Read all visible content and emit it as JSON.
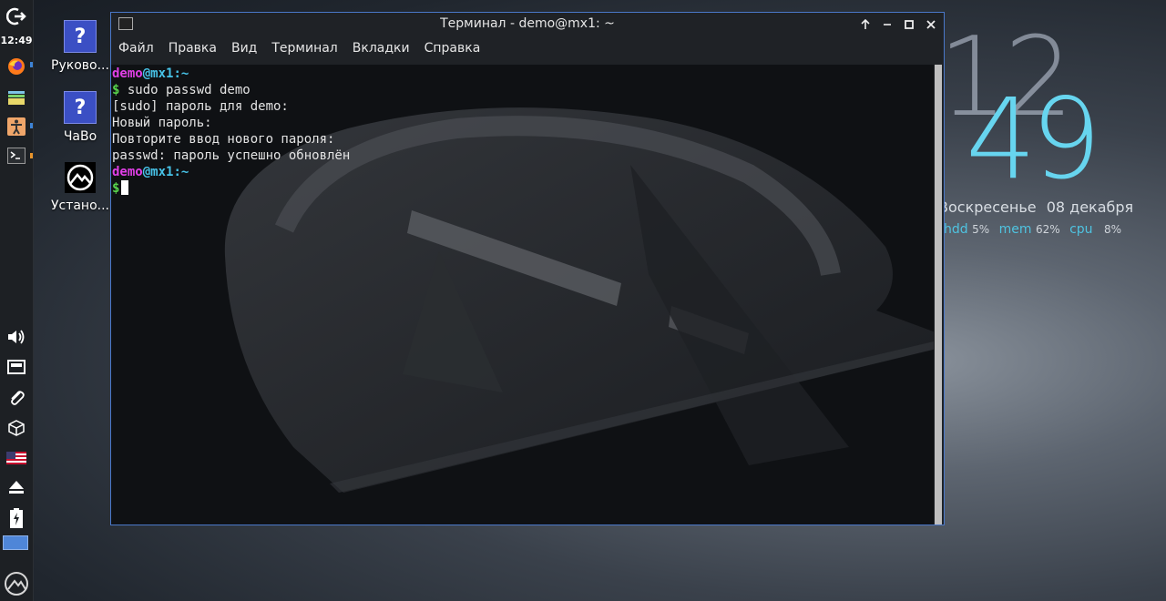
{
  "panel": {
    "time": "12:49",
    "indicator_color": "#3d83d6"
  },
  "desktop": {
    "icons": [
      {
        "label": "Руково...",
        "icon": "help-icon"
      },
      {
        "label": "ЧаВо",
        "icon": "help-icon"
      },
      {
        "label": "Устано...",
        "icon": "mx-installer-icon"
      }
    ]
  },
  "conky": {
    "hour": "12",
    "minute": "49",
    "weekday": "Воскресенье",
    "date": "08 декабря",
    "stats": [
      {
        "label": "hdd",
        "value": "5%"
      },
      {
        "label": "mem",
        "value": "62%"
      },
      {
        "label": "cpu",
        "value": "8%"
      }
    ]
  },
  "terminal": {
    "title": "Терминал - demo@mx1: ~",
    "menu": [
      "Файл",
      "Правка",
      "Вид",
      "Терминал",
      "Вкладки",
      "Справка"
    ],
    "user": "demo",
    "host": "mx1",
    "path": "~",
    "command": "sudo passwd demo",
    "output": [
      "[sudo] пароль для demo:",
      "Новый пароль:",
      "Повторите ввод нового пароля:",
      "passwd: пароль успешно обновлён"
    ]
  }
}
